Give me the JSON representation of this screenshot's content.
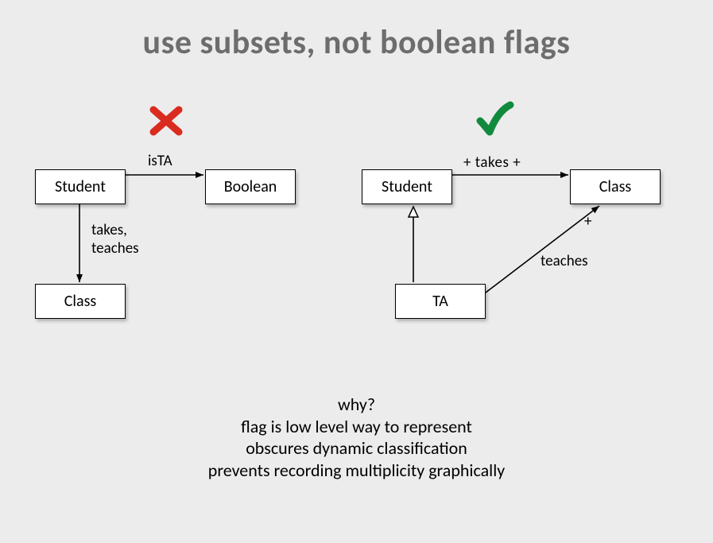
{
  "title": "use subsets, not boolean flags",
  "left": {
    "boxes": {
      "student": "Student",
      "boolean": "Boolean",
      "class": "Class"
    },
    "labels": {
      "isTA": "isTA",
      "takes_teaches": "takes,\nteaches"
    }
  },
  "right": {
    "boxes": {
      "student": "Student",
      "class": "Class",
      "ta": "TA"
    },
    "labels": {
      "takes": "+  takes  +",
      "teaches": "teaches",
      "plus": "+"
    }
  },
  "footer": {
    "l1": "why?",
    "l2": "flag is low level way to represent",
    "l3": "obscures dynamic classification",
    "l4": "prevents recording multiplicity graphically"
  }
}
